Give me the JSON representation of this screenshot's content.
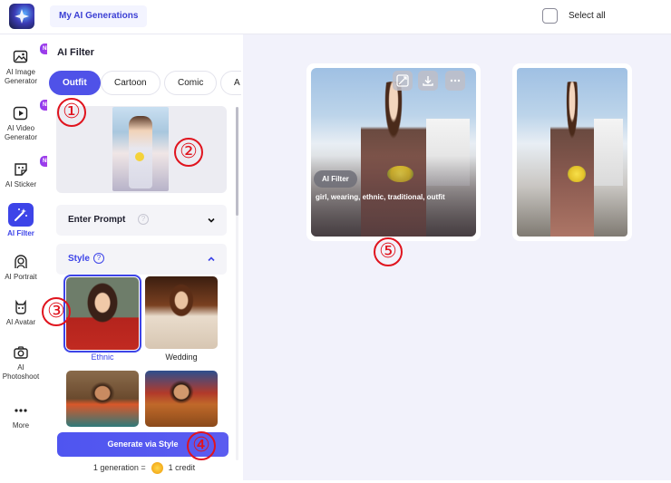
{
  "topbar": {
    "title": "My AI Generations",
    "select_all_label": "Select all"
  },
  "sidebar": {
    "items": [
      {
        "label": "AI Image Generator",
        "icon": "image-generator-icon",
        "badge": "NEW"
      },
      {
        "label": "AI Video Generator",
        "icon": "video-generator-icon",
        "badge": "NEW"
      },
      {
        "label": "AI Sticker",
        "icon": "sticker-icon",
        "badge": "NEW"
      },
      {
        "label": "AI Filter",
        "icon": "magic-wand-icon",
        "active": true
      },
      {
        "label": "AI Portrait",
        "icon": "portrait-icon"
      },
      {
        "label": "AI Avatar",
        "icon": "avatar-icon"
      },
      {
        "label": "AI Photoshoot",
        "icon": "camera-icon"
      },
      {
        "label": "More",
        "icon": "more-icon"
      }
    ]
  },
  "panel": {
    "title": "AI Filter",
    "chips": [
      "Outfit",
      "Cartoon",
      "Comic",
      "A"
    ],
    "enter_prompt_label": "Enter Prompt",
    "style_label": "Style",
    "styles": [
      {
        "label": "Ethnic",
        "selected": true
      },
      {
        "label": "Wedding"
      },
      {
        "label": ""
      },
      {
        "label": ""
      }
    ],
    "generate_label": "Generate via Style",
    "credit_left": "1 generation =",
    "credit_right": "1 credit"
  },
  "results": {
    "filter_tag": "AI Filter",
    "prompt": "girl, wearing, ethnic, traditional, outfit"
  },
  "annotations": [
    "①",
    "②",
    "③",
    "④",
    "⑤"
  ],
  "colors": {
    "accent": "#3d44e8",
    "annotation": "#e0141e",
    "background": "#f2f2fb"
  }
}
